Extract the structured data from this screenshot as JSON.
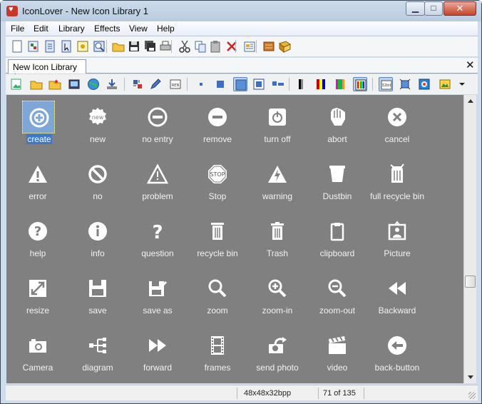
{
  "window": {
    "title": "IconLover - New Icon Library 1"
  },
  "menu": [
    "File",
    "Edit",
    "Library",
    "Effects",
    "View",
    "Help"
  ],
  "tab": {
    "label": "New Icon Library 1"
  },
  "icons": [
    {
      "label": "create",
      "icon": "create-icon",
      "selected": true
    },
    {
      "label": "new",
      "icon": "new-badge-icon"
    },
    {
      "label": "no entry",
      "icon": "no-entry-icon"
    },
    {
      "label": "remove",
      "icon": "remove-icon"
    },
    {
      "label": "turn off",
      "icon": "power-icon"
    },
    {
      "label": "abort",
      "icon": "hand-stop-icon"
    },
    {
      "label": "cancel",
      "icon": "cancel-icon"
    },
    {
      "label": "error",
      "icon": "error-triangle-icon"
    },
    {
      "label": "no",
      "icon": "prohibited-icon"
    },
    {
      "label": "problem",
      "icon": "problem-triangle-icon"
    },
    {
      "label": "Stop",
      "icon": "stop-sign-icon"
    },
    {
      "label": "warning",
      "icon": "warning-icon"
    },
    {
      "label": "Dustbin",
      "icon": "dustbin-icon"
    },
    {
      "label": "full recycle bin",
      "icon": "full-recycle-bin-icon"
    },
    {
      "label": "help",
      "icon": "help-icon"
    },
    {
      "label": "info",
      "icon": "info-icon"
    },
    {
      "label": "question",
      "icon": "question-icon"
    },
    {
      "label": "recycle bin",
      "icon": "recycle-bin-icon"
    },
    {
      "label": "Trash",
      "icon": "trash-icon"
    },
    {
      "label": "clipboard",
      "icon": "clipboard-icon"
    },
    {
      "label": "Picture",
      "icon": "picture-icon"
    },
    {
      "label": "resize",
      "icon": "resize-icon"
    },
    {
      "label": "save",
      "icon": "save-icon"
    },
    {
      "label": "save as",
      "icon": "save-as-icon"
    },
    {
      "label": "zoom",
      "icon": "zoom-icon"
    },
    {
      "label": "zoom-in",
      "icon": "zoom-in-icon"
    },
    {
      "label": "zoom-out",
      "icon": "zoom-out-icon"
    },
    {
      "label": "Backward",
      "icon": "backward-icon"
    },
    {
      "label": "Camera",
      "icon": "camera-icon"
    },
    {
      "label": "diagram",
      "icon": "diagram-icon"
    },
    {
      "label": "forward",
      "icon": "forward-icon"
    },
    {
      "label": "frames",
      "icon": "film-frames-icon"
    },
    {
      "label": "send photo",
      "icon": "send-photo-icon"
    },
    {
      "label": "video",
      "icon": "clapperboard-icon"
    },
    {
      "label": "back-button",
      "icon": "back-button-icon"
    }
  ],
  "toolbar1_icons": [
    "new-file-icon",
    "new-library-icon",
    "document-icon",
    "cursor-icon",
    "open-image-icon",
    "open-library-icon",
    "open-folder-icon",
    "save-icon",
    "save-all-icon",
    "print-icon",
    "cut-icon",
    "copy-icon",
    "paste-icon",
    "delete-icon",
    "properties-icon",
    "extract-icon",
    "library-book-icon"
  ],
  "toolbar2_icons": [
    "add-image-icon",
    "open-folder-icon",
    "folder-star-icon",
    "export-icon",
    "globe-icon",
    "download-icon",
    "crop-icon",
    "pencil-icon",
    "rename-icon",
    "size-small-icon",
    "size-medium-icon",
    "size-large-icon",
    "size-xl-icon",
    "size-frame-icon",
    "bw-palette-icon",
    "16-color-palette-icon",
    "256-color-palette-icon",
    "truecolor-palette-icon",
    "xp-format-icon",
    "resize-tool-icon",
    "preview-icon",
    "background-icon",
    "dropdown-icon"
  ],
  "status": {
    "format": "48x48x32bpp",
    "position": "71 of 135"
  },
  "colors": {
    "grid_background": "#808080",
    "selection": "#3f78c9"
  }
}
